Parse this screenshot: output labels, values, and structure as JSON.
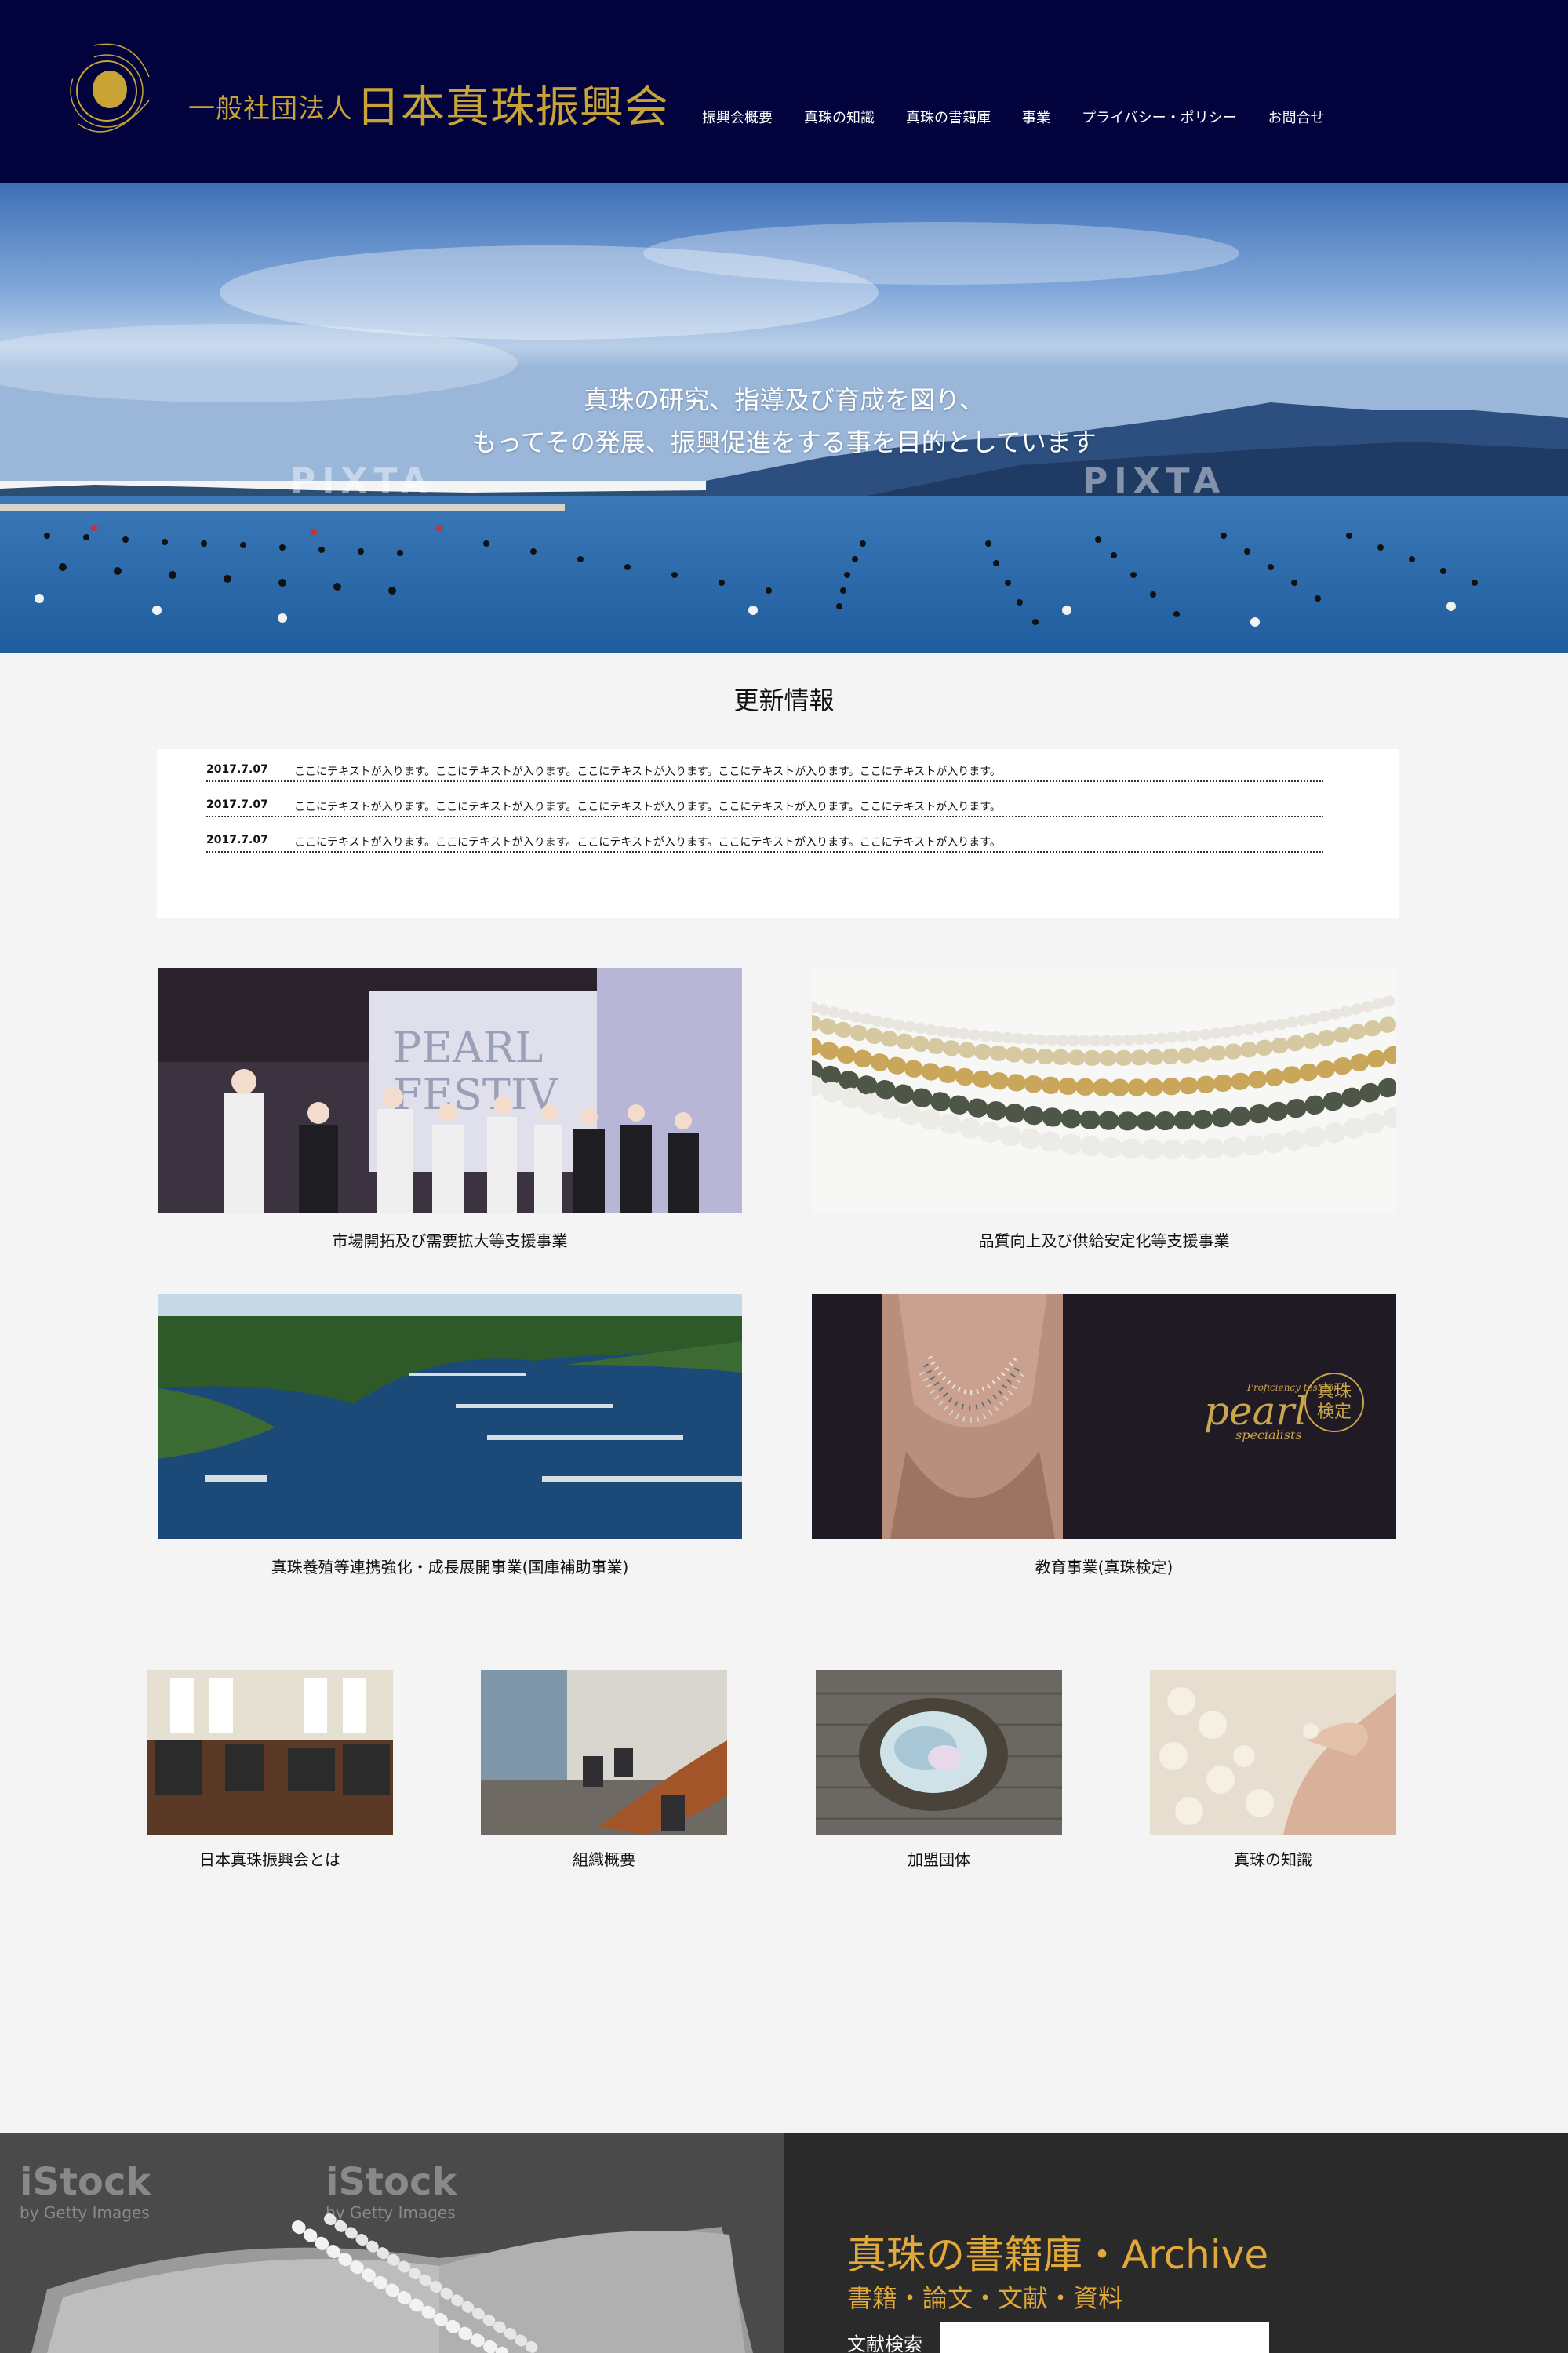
{
  "header": {
    "org_name_prefix": "一般社団法人",
    "org_name_main": "日本真珠振興会",
    "nav": [
      "振興会概要",
      "真珠の知識",
      "真珠の書籍庫",
      "事業",
      "プライバシー・ポリシー",
      "お問合せ"
    ]
  },
  "hero": {
    "line1": "真珠の研究、指導及び育成を図り、",
    "line2": "もってその発展、振興促進をする事を目的としています",
    "watermark": "PIXTA"
  },
  "news": {
    "title": "更新情報",
    "items": [
      {
        "date": "2017.7.07",
        "text": "ここにテキストが入ります。ここにテキストが入ります。ここにテキストが入ります。ここにテキストが入ります。ここにテキストが入ります。"
      },
      {
        "date": "2017.7.07",
        "text": "ここにテキストが入ります。ここにテキストが入ります。ここにテキストが入ります。ここにテキストが入ります。ここにテキストが入ります。"
      },
      {
        "date": "2017.7.07",
        "text": "ここにテキストが入ります。ここにテキストが入ります。ここにテキストが入ります。ここにテキストが入ります。ここにテキストが入ります。"
      }
    ]
  },
  "projects": [
    {
      "caption": "市場開拓及び需要拡大等支援事業"
    },
    {
      "caption": "品質向上及び供給安定化等支援事業"
    },
    {
      "caption": "真珠養殖等連携強化・成長展開事業(国庫補助事業)"
    },
    {
      "caption": "教育事業(真珠検定)",
      "badge_text": "pearl",
      "badge_sub": "specialists",
      "badge_top": "Proficiency test for",
      "badge_seal1": "真珠",
      "badge_seal2": "検定"
    }
  ],
  "links": [
    {
      "caption": "日本真珠振興会とは"
    },
    {
      "caption": "組織概要"
    },
    {
      "caption": "加盟団体"
    },
    {
      "caption": "真珠の知識"
    }
  ],
  "footer": {
    "title": "真珠の書籍庫・Archive",
    "subtitle": "書籍・論文・文献・資料",
    "search_label": "文献検索",
    "search_value": "",
    "watermark": "iStock",
    "watermark_sub": "by Getty Images"
  },
  "colors": {
    "header_bg": "#02033d",
    "gold": "#c8a437",
    "archive_gold": "#e0a93a",
    "page_bg": "#f4f4f4"
  }
}
